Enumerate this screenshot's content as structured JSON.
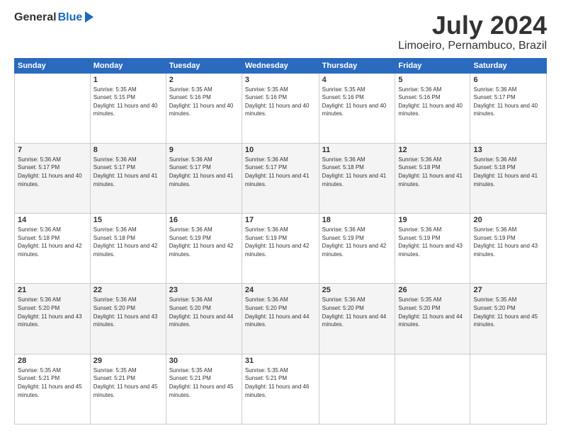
{
  "logo": {
    "general": "General",
    "blue": "Blue"
  },
  "header": {
    "month": "July 2024",
    "location": "Limoeiro, Pernambuco, Brazil"
  },
  "days_of_week": [
    "Sunday",
    "Monday",
    "Tuesday",
    "Wednesday",
    "Thursday",
    "Friday",
    "Saturday"
  ],
  "weeks": [
    [
      {
        "day": "",
        "sunrise": "",
        "sunset": "",
        "daylight": ""
      },
      {
        "day": "1",
        "sunrise": "Sunrise: 5:35 AM",
        "sunset": "Sunset: 5:15 PM",
        "daylight": "Daylight: 11 hours and 40 minutes."
      },
      {
        "day": "2",
        "sunrise": "Sunrise: 5:35 AM",
        "sunset": "Sunset: 5:16 PM",
        "daylight": "Daylight: 11 hours and 40 minutes."
      },
      {
        "day": "3",
        "sunrise": "Sunrise: 5:35 AM",
        "sunset": "Sunset: 5:16 PM",
        "daylight": "Daylight: 11 hours and 40 minutes."
      },
      {
        "day": "4",
        "sunrise": "Sunrise: 5:35 AM",
        "sunset": "Sunset: 5:16 PM",
        "daylight": "Daylight: 11 hours and 40 minutes."
      },
      {
        "day": "5",
        "sunrise": "Sunrise: 5:36 AM",
        "sunset": "Sunset: 5:16 PM",
        "daylight": "Daylight: 11 hours and 40 minutes."
      },
      {
        "day": "6",
        "sunrise": "Sunrise: 5:36 AM",
        "sunset": "Sunset: 5:17 PM",
        "daylight": "Daylight: 11 hours and 40 minutes."
      }
    ],
    [
      {
        "day": "7",
        "sunrise": "Sunrise: 5:36 AM",
        "sunset": "Sunset: 5:17 PM",
        "daylight": "Daylight: 11 hours and 40 minutes."
      },
      {
        "day": "8",
        "sunrise": "Sunrise: 5:36 AM",
        "sunset": "Sunset: 5:17 PM",
        "daylight": "Daylight: 11 hours and 41 minutes."
      },
      {
        "day": "9",
        "sunrise": "Sunrise: 5:36 AM",
        "sunset": "Sunset: 5:17 PM",
        "daylight": "Daylight: 11 hours and 41 minutes."
      },
      {
        "day": "10",
        "sunrise": "Sunrise: 5:36 AM",
        "sunset": "Sunset: 5:17 PM",
        "daylight": "Daylight: 11 hours and 41 minutes."
      },
      {
        "day": "11",
        "sunrise": "Sunrise: 5:36 AM",
        "sunset": "Sunset: 5:18 PM",
        "daylight": "Daylight: 11 hours and 41 minutes."
      },
      {
        "day": "12",
        "sunrise": "Sunrise: 5:36 AM",
        "sunset": "Sunset: 5:18 PM",
        "daylight": "Daylight: 11 hours and 41 minutes."
      },
      {
        "day": "13",
        "sunrise": "Sunrise: 5:36 AM",
        "sunset": "Sunset: 5:18 PM",
        "daylight": "Daylight: 11 hours and 41 minutes."
      }
    ],
    [
      {
        "day": "14",
        "sunrise": "Sunrise: 5:36 AM",
        "sunset": "Sunset: 5:18 PM",
        "daylight": "Daylight: 11 hours and 42 minutes."
      },
      {
        "day": "15",
        "sunrise": "Sunrise: 5:36 AM",
        "sunset": "Sunset: 5:18 PM",
        "daylight": "Daylight: 11 hours and 42 minutes."
      },
      {
        "day": "16",
        "sunrise": "Sunrise: 5:36 AM",
        "sunset": "Sunset: 5:19 PM",
        "daylight": "Daylight: 11 hours and 42 minutes."
      },
      {
        "day": "17",
        "sunrise": "Sunrise: 5:36 AM",
        "sunset": "Sunset: 5:19 PM",
        "daylight": "Daylight: 11 hours and 42 minutes."
      },
      {
        "day": "18",
        "sunrise": "Sunrise: 5:36 AM",
        "sunset": "Sunset: 5:19 PM",
        "daylight": "Daylight: 11 hours and 42 minutes."
      },
      {
        "day": "19",
        "sunrise": "Sunrise: 5:36 AM",
        "sunset": "Sunset: 5:19 PM",
        "daylight": "Daylight: 11 hours and 43 minutes."
      },
      {
        "day": "20",
        "sunrise": "Sunrise: 5:36 AM",
        "sunset": "Sunset: 5:19 PM",
        "daylight": "Daylight: 11 hours and 43 minutes."
      }
    ],
    [
      {
        "day": "21",
        "sunrise": "Sunrise: 5:36 AM",
        "sunset": "Sunset: 5:20 PM",
        "daylight": "Daylight: 11 hours and 43 minutes."
      },
      {
        "day": "22",
        "sunrise": "Sunrise: 5:36 AM",
        "sunset": "Sunset: 5:20 PM",
        "daylight": "Daylight: 11 hours and 43 minutes."
      },
      {
        "day": "23",
        "sunrise": "Sunrise: 5:36 AM",
        "sunset": "Sunset: 5:20 PM",
        "daylight": "Daylight: 11 hours and 44 minutes."
      },
      {
        "day": "24",
        "sunrise": "Sunrise: 5:36 AM",
        "sunset": "Sunset: 5:20 PM",
        "daylight": "Daylight: 11 hours and 44 minutes."
      },
      {
        "day": "25",
        "sunrise": "Sunrise: 5:36 AM",
        "sunset": "Sunset: 5:20 PM",
        "daylight": "Daylight: 11 hours and 44 minutes."
      },
      {
        "day": "26",
        "sunrise": "Sunrise: 5:35 AM",
        "sunset": "Sunset: 5:20 PM",
        "daylight": "Daylight: 11 hours and 44 minutes."
      },
      {
        "day": "27",
        "sunrise": "Sunrise: 5:35 AM",
        "sunset": "Sunset: 5:20 PM",
        "daylight": "Daylight: 11 hours and 45 minutes."
      }
    ],
    [
      {
        "day": "28",
        "sunrise": "Sunrise: 5:35 AM",
        "sunset": "Sunset: 5:21 PM",
        "daylight": "Daylight: 11 hours and 45 minutes."
      },
      {
        "day": "29",
        "sunrise": "Sunrise: 5:35 AM",
        "sunset": "Sunset: 5:21 PM",
        "daylight": "Daylight: 11 hours and 45 minutes."
      },
      {
        "day": "30",
        "sunrise": "Sunrise: 5:35 AM",
        "sunset": "Sunset: 5:21 PM",
        "daylight": "Daylight: 11 hours and 45 minutes."
      },
      {
        "day": "31",
        "sunrise": "Sunrise: 5:35 AM",
        "sunset": "Sunset: 5:21 PM",
        "daylight": "Daylight: 11 hours and 46 minutes."
      },
      {
        "day": "",
        "sunrise": "",
        "sunset": "",
        "daylight": ""
      },
      {
        "day": "",
        "sunrise": "",
        "sunset": "",
        "daylight": ""
      },
      {
        "day": "",
        "sunrise": "",
        "sunset": "",
        "daylight": ""
      }
    ]
  ]
}
